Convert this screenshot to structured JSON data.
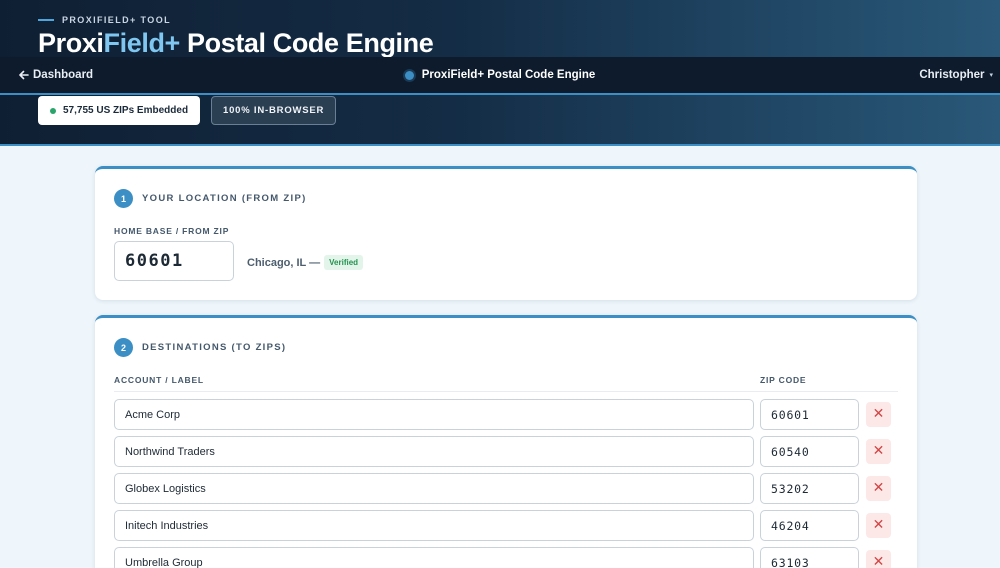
{
  "header": {
    "eyebrow": "PROXIFIELD+ TOOL",
    "title_part1": "Proxi",
    "title_part2": "Field+",
    "title_part3": " Postal Code Engine"
  },
  "nav": {
    "back_label": "Dashboard",
    "back_icon": "arrow-left-icon",
    "center_title": "ProxiField+ Postal Code Engine",
    "user_name": "Christopher",
    "user_caret": "▾"
  },
  "badges": {
    "zips_embedded": "57,755 US ZIPs Embedded",
    "in_browser": "100% IN-BROWSER"
  },
  "location": {
    "step": "1",
    "section_title": "YOUR LOCATION (FROM ZIP)",
    "field_label": "HOME BASE / FROM ZIP",
    "zip_value": "60601",
    "resolved_city": "Chicago, IL —",
    "status": "Verified"
  },
  "destinations": {
    "step": "2",
    "section_title": "DESTINATIONS (TO ZIPS)",
    "col_account": "ACCOUNT / LABEL",
    "col_zip": "ZIP CODE",
    "remove_glyph": "✕",
    "rows": [
      {
        "label": "Acme Corp",
        "zip": "60601"
      },
      {
        "label": "Northwind Traders",
        "zip": "60540"
      },
      {
        "label": "Globex Logistics",
        "zip": "53202"
      },
      {
        "label": "Initech Industries",
        "zip": "46204"
      },
      {
        "label": "Umbrella Group",
        "zip": "63103"
      }
    ]
  },
  "colors": {
    "accent": "#3b8fc4",
    "hero_dark": "#0f1f33",
    "verified_green": "#23924f",
    "remove_red": "#d24646"
  }
}
